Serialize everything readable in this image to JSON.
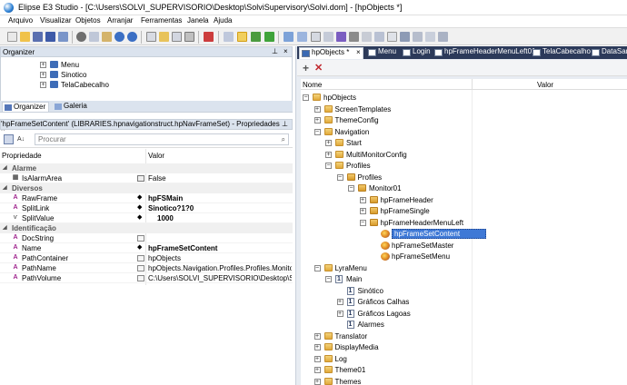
{
  "window": {
    "title": "Elipse E3 Studio - [C:\\Users\\SOLVI_SUPERVISORIO\\Desktop\\SolviSupervisory\\Solvi.dom] - [hpObjects *]"
  },
  "menu": [
    "Arquivo",
    "Visualizar",
    "Objetos",
    "Arranjar",
    "Ferramentas",
    "Janela",
    "Ajuda"
  ],
  "organizer": {
    "title": "Organizer",
    "pin": "ₕ ×",
    "items": [
      "Menu",
      "Sinotico",
      "TelaCabecalho"
    ],
    "tabs": [
      "Organizer",
      "Galeria"
    ]
  },
  "properties": {
    "title": "'hpFrameSetContent' (LIBRARIES.hpnavigationstruct.hpNavFrameSet) - Propriedades",
    "search_placeholder": "Procurar",
    "col_name": "Propriedade",
    "col_value": "Valor",
    "categories": [
      {
        "name": "Alarme",
        "rows": [
          {
            "name": "IsAlarmArea",
            "value": "False",
            "bold": false
          }
        ]
      },
      {
        "name": "Diversos",
        "rows": [
          {
            "name": "RawFrame",
            "value": "hpFSMain",
            "bold": true
          },
          {
            "name": "SplitLink",
            "value": "Sinotico?1?0",
            "bold": true
          },
          {
            "name": "SplitValue",
            "value": "1000",
            "bold": true
          }
        ]
      },
      {
        "name": "Identificação",
        "rows": [
          {
            "name": "DocString",
            "value": "",
            "bold": false
          },
          {
            "name": "Name",
            "value": "hpFrameSetContent",
            "bold": true
          },
          {
            "name": "PathContainer",
            "value": "hpObjects",
            "bold": false
          },
          {
            "name": "PathName",
            "value": "hpObjects.Navigation.Profiles.Profiles.Monitor...",
            "bold": false
          },
          {
            "name": "PathVolume",
            "value": "C:\\Users\\SOLVI_SUPERVISORIO\\Desktop\\Solvi...",
            "bold": false
          }
        ]
      }
    ]
  },
  "doc_tabs": [
    "hpObjects *",
    "Menu",
    "Login",
    "hpFrameHeaderMenuLeft01",
    "TelaCabecalho",
    "DataSanit"
  ],
  "tree": {
    "col_name": "Nome",
    "col_value": "Valor",
    "nodes": [
      {
        "label": "hpObjects",
        "exp": "-",
        "icon": "fold"
      },
      {
        "label": "ScreenTemplates",
        "exp": "+",
        "icon": "fold"
      },
      {
        "label": "ThemeConfig",
        "exp": "+",
        "icon": "fold"
      },
      {
        "label": "Navigation",
        "exp": "-",
        "icon": "fold"
      },
      {
        "label": "Start",
        "exp": "+",
        "icon": "fold"
      },
      {
        "label": "MultiMonitorConfig",
        "exp": "+",
        "icon": "fold"
      },
      {
        "label": "Profiles",
        "exp": "-",
        "icon": "fold"
      },
      {
        "label": "Profiles",
        "exp": "-",
        "icon": "fold2"
      },
      {
        "label": "Monitor01",
        "exp": "-",
        "icon": "fold2"
      },
      {
        "label": "hpFrameHeader",
        "exp": "+",
        "icon": "fold2"
      },
      {
        "label": "hpFrameSingle",
        "exp": "+",
        "icon": "fold2"
      },
      {
        "label": "hpFrameHeaderMenuLeft",
        "exp": "-",
        "icon": "fold2"
      },
      {
        "label": "hpFrameSetContent",
        "exp": "",
        "icon": "frame"
      },
      {
        "label": "hpFrameSetMaster",
        "exp": "",
        "icon": "frame"
      },
      {
        "label": "hpFrameSetMenu",
        "exp": "",
        "icon": "frame"
      },
      {
        "label": "LyraMenu",
        "exp": "-",
        "icon": "fold"
      },
      {
        "label": "Main",
        "exp": "-",
        "icon": "num"
      },
      {
        "label": "Sinótico",
        "exp": "",
        "icon": "num"
      },
      {
        "label": "Gráficos Calhas",
        "exp": "+",
        "icon": "num"
      },
      {
        "label": "Gráficos Lagoas",
        "exp": "+",
        "icon": "num"
      },
      {
        "label": "Alarmes",
        "exp": "",
        "icon": "num"
      },
      {
        "label": "Translator",
        "exp": "+",
        "icon": "fold"
      },
      {
        "label": "DisplayMedia",
        "exp": "+",
        "icon": "fold"
      },
      {
        "label": "Log",
        "exp": "+",
        "icon": "fold"
      },
      {
        "label": "Theme01",
        "exp": "+",
        "icon": "fold"
      },
      {
        "label": "Themes",
        "exp": "+",
        "icon": "fold"
      }
    ]
  }
}
